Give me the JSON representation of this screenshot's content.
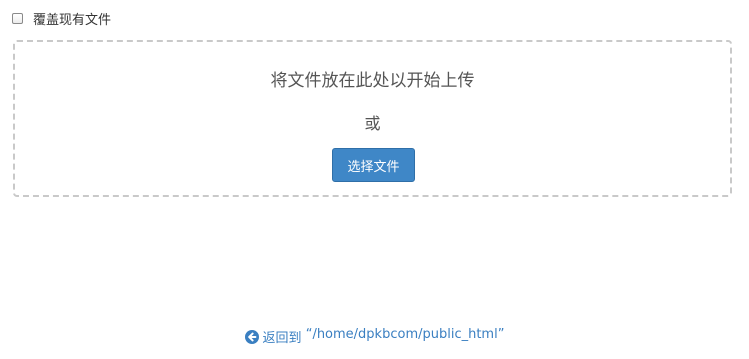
{
  "overwrite": {
    "label": "覆盖现有文件",
    "checked": false
  },
  "dropzone": {
    "message": "将文件放在此处以开始上传",
    "or_text": "或",
    "select_button_label": "选择文件"
  },
  "back_link": {
    "icon": "circle-arrow-left-icon",
    "prefix": "返回到",
    "path": "“/home/dpkbcom/public_html”"
  },
  "colors": {
    "accent": "#3f87c7",
    "link": "#3a7fc1",
    "dash_border": "#c9c9c9"
  }
}
